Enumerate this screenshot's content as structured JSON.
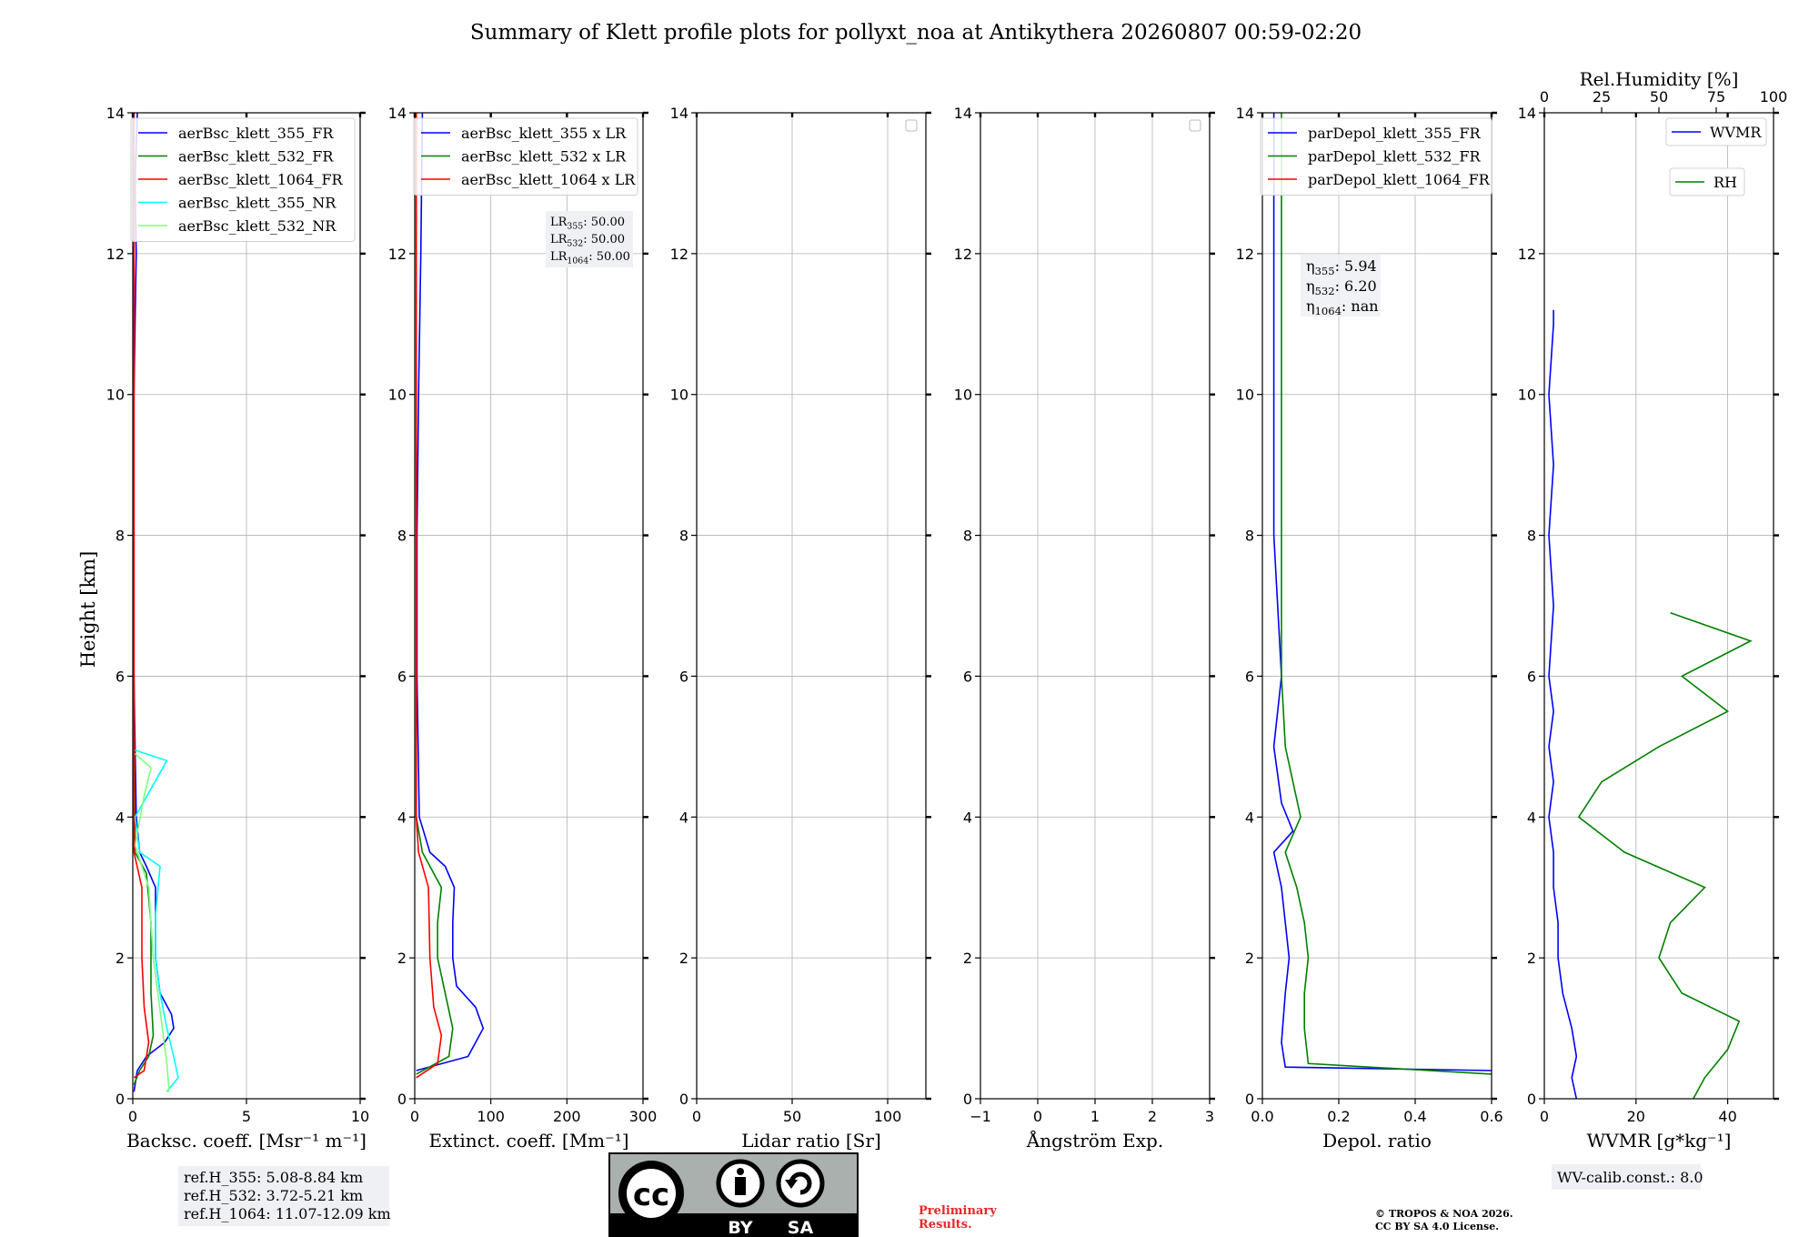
{
  "figure": {
    "title": "Summary of Klett profile plots for pollyxt_noa at Antikythera 20260807 00:59-02:20",
    "ylabel": "Height [km]",
    "preliminary": [
      "Preliminary",
      "Results."
    ],
    "copyright": [
      "© TROPOS & NOA 2026.",
      "CC BY SA 4.0 License."
    ],
    "cc_badge": {
      "cc": "cc",
      "by": "BY",
      "sa": "SA"
    }
  },
  "chart_data": [
    {
      "id": "bsc",
      "type": "line",
      "xlabel": "Backsc. coeff. [Msr⁻¹ m⁻¹]",
      "xlim": [
        0,
        10
      ],
      "ylim": [
        0,
        14
      ],
      "xticks": [
        0,
        5,
        10
      ],
      "yticks": [
        0,
        2,
        4,
        6,
        8,
        10,
        12,
        14
      ],
      "grid": true,
      "legend_position": "top-right",
      "series": [
        {
          "name": "aerBsc_klett_355_FR",
          "color": "#0000ff",
          "points": [
            [
              0.05,
              0.1
            ],
            [
              0.2,
              0.4
            ],
            [
              0.6,
              0.6
            ],
            [
              1.4,
              0.8
            ],
            [
              1.8,
              1.0
            ],
            [
              1.7,
              1.2
            ],
            [
              1.2,
              1.5
            ],
            [
              1.0,
              2.0
            ],
            [
              1.0,
              2.5
            ],
            [
              1.0,
              3.0
            ],
            [
              0.6,
              3.3
            ],
            [
              0.3,
              3.5
            ],
            [
              0.15,
              4.0
            ],
            [
              0.05,
              6.0
            ],
            [
              0.05,
              8.0
            ],
            [
              0.05,
              10.0
            ],
            [
              0.1,
              11.0
            ],
            [
              0.15,
              12.0
            ],
            [
              0.1,
              13.0
            ],
            [
              0.2,
              14.0
            ]
          ]
        },
        {
          "name": "aerBsc_klett_532_FR",
          "color": "#008000",
          "points": [
            [
              0.05,
              0.2
            ],
            [
              0.3,
              0.4
            ],
            [
              0.7,
              0.6
            ],
            [
              0.9,
              0.9
            ],
            [
              0.8,
              1.5
            ],
            [
              0.8,
              2.5
            ],
            [
              0.6,
              3.2
            ],
            [
              0.1,
              3.5
            ],
            [
              0.05,
              6.0
            ],
            [
              0.05,
              14.0
            ]
          ]
        },
        {
          "name": "aerBsc_klett_1064_FR",
          "color": "#ff0000",
          "points": [
            [
              0.05,
              0.3
            ],
            [
              0.5,
              0.4
            ],
            [
              0.7,
              0.8
            ],
            [
              0.5,
              1.3
            ],
            [
              0.4,
              2.0
            ],
            [
              0.4,
              3.0
            ],
            [
              0.05,
              3.5
            ],
            [
              0.05,
              14.0
            ]
          ]
        },
        {
          "name": "aerBsc_klett_355_NR",
          "color": "#00ffff",
          "points": [
            [
              1.5,
              0.1
            ],
            [
              2.0,
              0.3
            ],
            [
              1.8,
              0.6
            ],
            [
              1.5,
              1.0
            ],
            [
              1.2,
              1.5
            ],
            [
              1.0,
              2.0
            ],
            [
              1.0,
              2.6
            ],
            [
              1.2,
              3.3
            ],
            [
              0.3,
              3.5
            ],
            [
              0.1,
              4.0
            ],
            [
              0.8,
              4.4
            ],
            [
              1.5,
              4.8
            ],
            [
              0.1,
              4.95
            ]
          ]
        },
        {
          "name": "aerBsc_klett_532_NR",
          "color": "#7fff7f",
          "points": [
            [
              1.6,
              0.1
            ],
            [
              1.5,
              0.5
            ],
            [
              1.3,
              1.0
            ],
            [
              0.9,
              2.0
            ],
            [
              0.7,
              3.0
            ],
            [
              0.1,
              3.6
            ],
            [
              0.5,
              4.3
            ],
            [
              0.8,
              4.7
            ],
            [
              0.1,
              4.9
            ]
          ]
        }
      ],
      "annotation": [
        "ref.H_355: 5.08-8.84 km",
        "ref.H_532: 3.72-5.21 km",
        "ref.H_1064: 11.07-12.09 km"
      ]
    },
    {
      "id": "ext",
      "type": "line",
      "xlabel": "Extinct. coeff. [Mm⁻¹]",
      "xlim": [
        0,
        300
      ],
      "ylim": [
        0,
        14
      ],
      "xticks": [
        0,
        100,
        200,
        300
      ],
      "yticks": [
        0,
        2,
        4,
        6,
        8,
        10,
        12,
        14
      ],
      "grid": true,
      "legend_position": "top-right",
      "series": [
        {
          "name": "aerBsc_klett_355 x LR",
          "color": "#0000ff",
          "points": [
            [
              2,
              0.4
            ],
            [
              70,
              0.6
            ],
            [
              90,
              1.0
            ],
            [
              80,
              1.3
            ],
            [
              55,
              1.6
            ],
            [
              50,
              2.0
            ],
            [
              50,
              2.5
            ],
            [
              52,
              3.0
            ],
            [
              40,
              3.3
            ],
            [
              20,
              3.5
            ],
            [
              6,
              4.0
            ],
            [
              3,
              6.0
            ],
            [
              3,
              8.0
            ],
            [
              5,
              10.0
            ],
            [
              8,
              12.0
            ],
            [
              10,
              14.0
            ]
          ]
        },
        {
          "name": "aerBsc_klett_532 x LR",
          "color": "#008000",
          "points": [
            [
              2,
              0.35
            ],
            [
              45,
              0.6
            ],
            [
              50,
              1.0
            ],
            [
              40,
              1.5
            ],
            [
              30,
              2.0
            ],
            [
              30,
              2.5
            ],
            [
              35,
              3.0
            ],
            [
              10,
              3.5
            ],
            [
              2,
              4.0
            ],
            [
              2,
              14.0
            ]
          ]
        },
        {
          "name": "aerBsc_klett_1064 x LR",
          "color": "#ff0000",
          "points": [
            [
              2,
              0.3
            ],
            [
              30,
              0.5
            ],
            [
              35,
              0.9
            ],
            [
              25,
              1.3
            ],
            [
              20,
              2.0
            ],
            [
              18,
              3.0
            ],
            [
              5,
              3.5
            ],
            [
              2,
              4.0
            ],
            [
              2,
              14.0
            ]
          ]
        }
      ],
      "annotation": [
        "LR355: 50.00",
        "LR532: 50.00",
        "LR1064: 50.00"
      ]
    },
    {
      "id": "lr",
      "type": "line",
      "xlabel": "Lidar ratio [Sr]",
      "xlim": [
        0,
        120
      ],
      "ylim": [
        0,
        14
      ],
      "xticks": [
        0,
        50,
        100
      ],
      "yticks": [
        0,
        2,
        4,
        6,
        8,
        10,
        12,
        14
      ],
      "grid": true,
      "legend_position": "top-right",
      "series": []
    },
    {
      "id": "ae",
      "type": "line",
      "xlabel": "Ångström Exp.",
      "xlim": [
        -1,
        3
      ],
      "ylim": [
        0,
        14
      ],
      "xticks": [
        -1,
        0,
        1,
        2,
        3
      ],
      "yticks": [
        0,
        2,
        4,
        6,
        8,
        10,
        12,
        14
      ],
      "grid": true,
      "legend_position": "top-right",
      "series": []
    },
    {
      "id": "depol",
      "type": "line",
      "xlabel": "Depol. ratio",
      "xlim": [
        0,
        0.6
      ],
      "ylim": [
        0,
        14
      ],
      "xticks": [
        0.0,
        0.2,
        0.4,
        0.6
      ],
      "yticks": [
        0,
        2,
        4,
        6,
        8,
        10,
        12,
        14
      ],
      "grid": true,
      "legend_position": "top-left",
      "series": [
        {
          "name": "parDepol_klett_355_FR",
          "color": "#0000ff",
          "points": [
            [
              0.6,
              0.4
            ],
            [
              0.06,
              0.45
            ],
            [
              0.05,
              0.8
            ],
            [
              0.06,
              1.5
            ],
            [
              0.07,
              2.0
            ],
            [
              0.06,
              2.5
            ],
            [
              0.05,
              3.0
            ],
            [
              0.03,
              3.5
            ],
            [
              0.08,
              3.8
            ],
            [
              0.05,
              4.2
            ],
            [
              0.03,
              5.0
            ],
            [
              0.05,
              6.0
            ],
            [
              0.03,
              8.0
            ],
            [
              0.03,
              10.0
            ],
            [
              0.03,
              12.0
            ],
            [
              0.03,
              14.0
            ]
          ]
        },
        {
          "name": "parDepol_klett_532_FR",
          "color": "#008000",
          "points": [
            [
              0.6,
              0.35
            ],
            [
              0.12,
              0.5
            ],
            [
              0.11,
              1.0
            ],
            [
              0.11,
              1.5
            ],
            [
              0.12,
              2.0
            ],
            [
              0.11,
              2.5
            ],
            [
              0.09,
              3.0
            ],
            [
              0.06,
              3.5
            ],
            [
              0.1,
              4.0
            ],
            [
              0.06,
              5.0
            ],
            [
              0.05,
              6.0
            ],
            [
              0.05,
              8.0
            ],
            [
              0.05,
              10.0
            ],
            [
              0.05,
              12.0
            ],
            [
              0.05,
              14.0
            ]
          ]
        },
        {
          "name": "parDepol_klett_1064_FR",
          "color": "#ff0000",
          "points": []
        }
      ],
      "annotation": [
        "η355: 5.94",
        "η532: 6.20",
        "η1064: nan"
      ]
    },
    {
      "id": "wv",
      "type": "line",
      "xlabel": "WVMR [g*kg⁻¹]",
      "xlim": [
        0,
        50
      ],
      "ylim": [
        0,
        14
      ],
      "xticks": [
        0,
        20,
        40
      ],
      "yticks": [
        0,
        2,
        4,
        6,
        8,
        10,
        12,
        14
      ],
      "top_xlabel": "Rel.Humidity [%]",
      "top_xlim": [
        0,
        100
      ],
      "top_xticks": [
        0,
        25,
        50,
        75,
        100
      ],
      "grid": true,
      "legend_position": "top-right",
      "series": [
        {
          "name": "WVMR",
          "color": "#0000ff",
          "points": [
            [
              7,
              0.0
            ],
            [
              6,
              0.3
            ],
            [
              7,
              0.6
            ],
            [
              6,
              1.0
            ],
            [
              4,
              1.5
            ],
            [
              3,
              2.0
            ],
            [
              3,
              2.5
            ],
            [
              2,
              3.0
            ],
            [
              2,
              3.5
            ],
            [
              1,
              4.0
            ],
            [
              2,
              4.5
            ],
            [
              1,
              5.0
            ],
            [
              2,
              5.5
            ],
            [
              1,
              6.0
            ],
            [
              2,
              7.0
            ],
            [
              1,
              8.0
            ],
            [
              2,
              9.0
            ],
            [
              1,
              10.0
            ],
            [
              2,
              11.0
            ],
            [
              2,
              11.2
            ]
          ]
        },
        {
          "name": "RH",
          "color": "#008000",
          "axis": "top",
          "points": [
            [
              65,
              0.0
            ],
            [
              70,
              0.3
            ],
            [
              80,
              0.7
            ],
            [
              85,
              1.1
            ],
            [
              60,
              1.5
            ],
            [
              50,
              2.0
            ],
            [
              55,
              2.5
            ],
            [
              70,
              3.0
            ],
            [
              35,
              3.5
            ],
            [
              15,
              4.0
            ],
            [
              25,
              4.5
            ],
            [
              50,
              5.0
            ],
            [
              80,
              5.5
            ],
            [
              60,
              6.0
            ],
            [
              90,
              6.5
            ],
            [
              55,
              6.9
            ]
          ]
        }
      ],
      "annotation": [
        "WV-calib.const.: 8.0"
      ]
    }
  ]
}
